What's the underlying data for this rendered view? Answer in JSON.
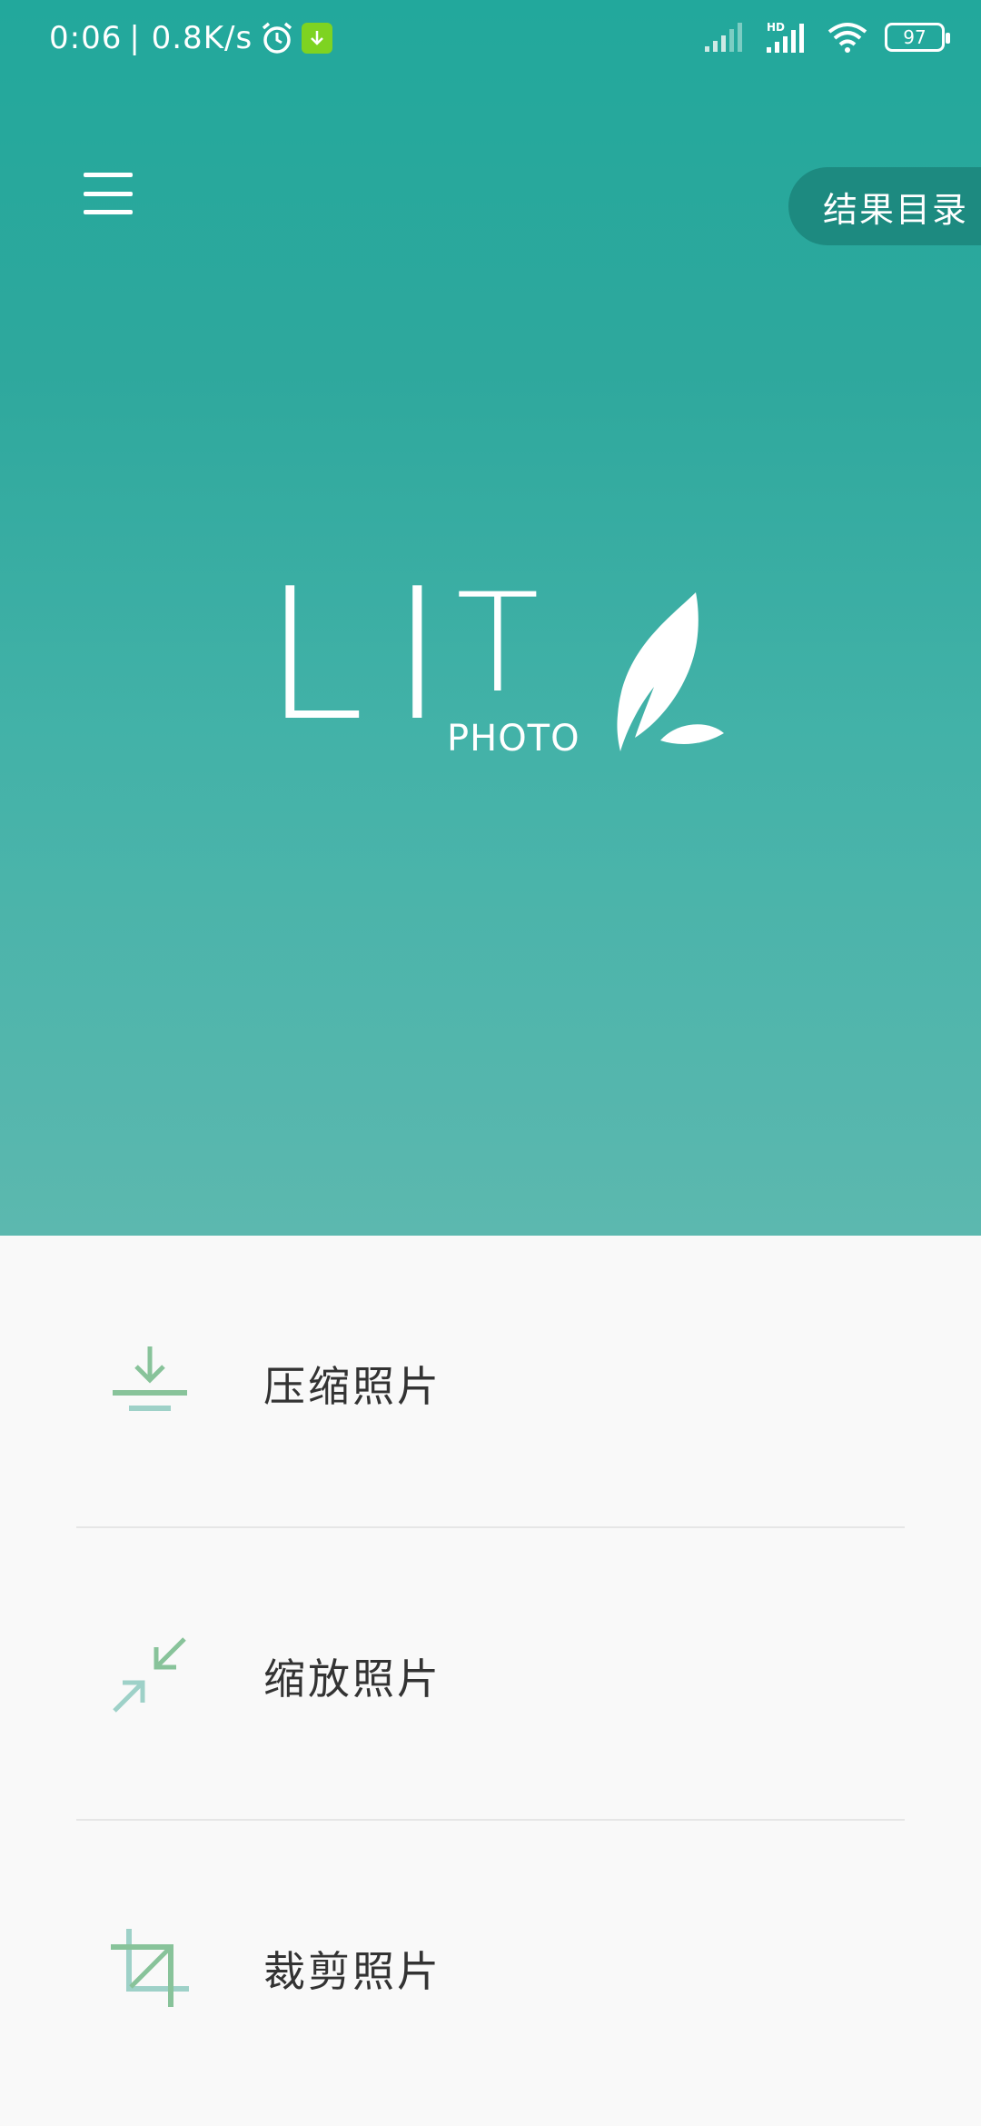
{
  "status_bar": {
    "time": "0:06",
    "speed": "| 0.8K/s",
    "battery": "97",
    "icons": [
      "alarm-icon",
      "download-icon",
      "signal-icon",
      "hd-signal-icon",
      "wifi-icon",
      "battery-icon"
    ]
  },
  "toolbar": {
    "menu_icon": "menu-icon",
    "result_dir_label": "结果目录"
  },
  "logo": {
    "letters": [
      "L",
      "I",
      "T"
    ],
    "sub": "PHOTO",
    "icon": "feather-icon"
  },
  "menu": {
    "items": [
      {
        "label": "压缩照片",
        "icon": "compress-icon"
      },
      {
        "label": "缩放照片",
        "icon": "resize-icon"
      },
      {
        "label": "裁剪照片",
        "icon": "crop-icon"
      }
    ]
  },
  "colors": {
    "primary": "#22a89c",
    "icon_green": "#88c39a",
    "icon_teal": "#9ed1c8"
  }
}
